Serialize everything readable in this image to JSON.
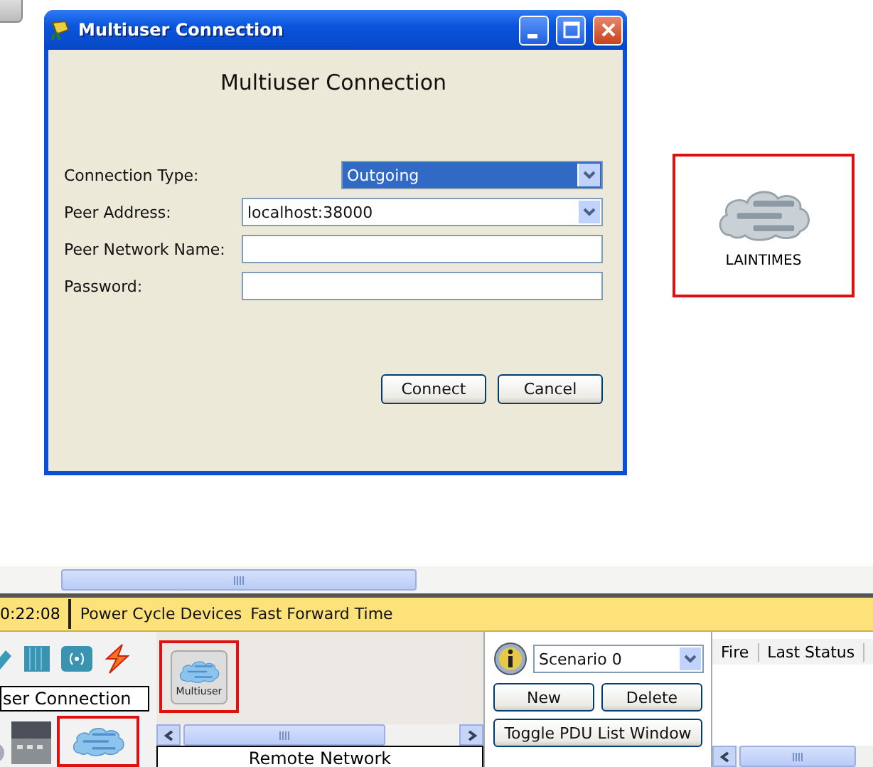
{
  "dialog": {
    "title": "Multiuser Connection",
    "heading": "Multiuser Connection",
    "fields": [
      {
        "kind": "select",
        "label": "Connection Type:",
        "value": "Outgoing",
        "focused": true
      },
      {
        "kind": "select",
        "label": "Peer Address:",
        "value": "localhost:38000",
        "focused": false
      },
      {
        "kind": "text",
        "label": "Peer Network Name:"
      },
      {
        "kind": "text",
        "label": "Password:"
      }
    ],
    "buttons": [
      "Connect",
      "Cancel"
    ]
  },
  "canvas_device": {
    "label": "LAINTIMES"
  },
  "status_bar": {
    "time": "0:22:08",
    "actions": [
      "Power Cycle Devices",
      "Fast Forward Time"
    ]
  },
  "device_panel": {
    "type_label": "ser Connection"
  },
  "device_list": {
    "items": [
      {
        "label": "Multiuser"
      }
    ],
    "title": "Remote Network"
  },
  "scenario": {
    "value": "Scenario 0",
    "buttons": [
      "New",
      "Delete"
    ],
    "toggle": "Toggle PDU List Window"
  },
  "pdu_list": {
    "columns": [
      "Fire",
      "Last Status"
    ]
  }
}
